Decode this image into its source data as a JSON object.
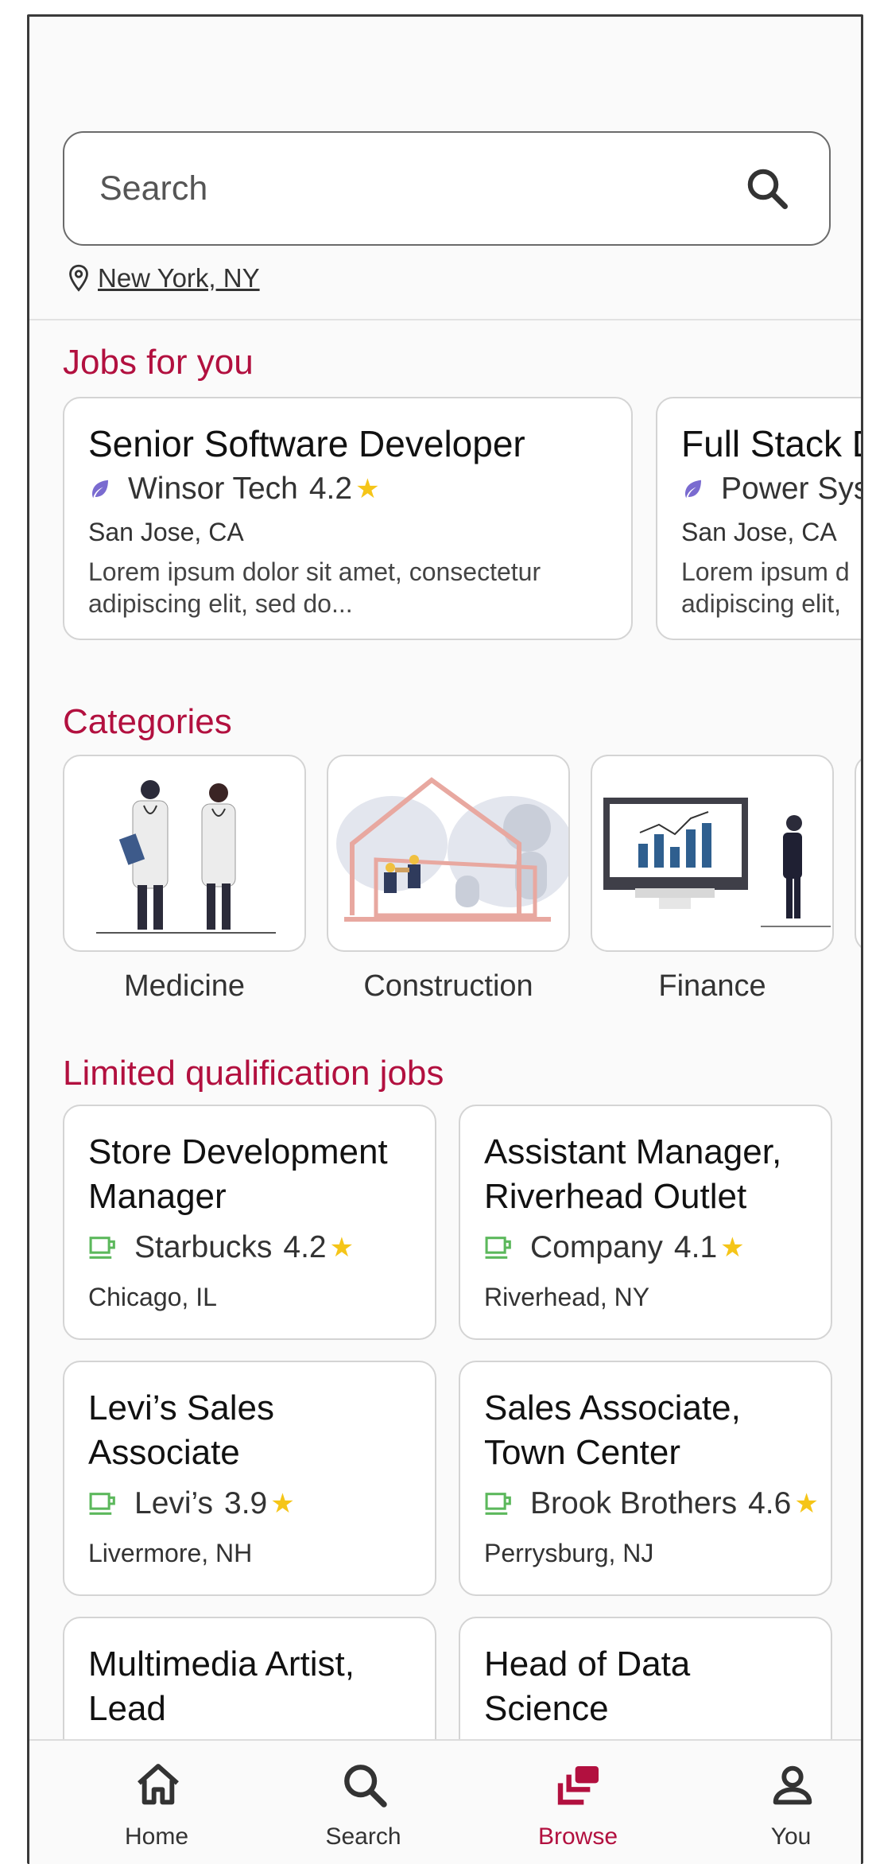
{
  "search": {
    "placeholder": "Search",
    "location": "New York, NY"
  },
  "sections": {
    "jobs_for_you": "Jobs for you",
    "categories": "Categories",
    "limited": "Limited qualification jobs"
  },
  "jobs_for_you": [
    {
      "title": "Senior Software Developer",
      "company": "Winsor Tech",
      "rating": "4.2",
      "location": "San Jose, CA",
      "description": "Lorem ipsum dolor sit amet, consectetur adipiscing elit, sed do..."
    },
    {
      "title": "Full Stack D",
      "company": "Power Sys",
      "location": "San Jose, CA",
      "description": "Lorem ipsum d adipiscing elit,"
    }
  ],
  "categories": [
    {
      "label": "Medicine"
    },
    {
      "label": "Construction"
    },
    {
      "label": "Finance"
    }
  ],
  "limited_jobs": [
    {
      "title": "Store Development Manager",
      "company": "Starbucks",
      "rating": "4.2",
      "location": "Chicago, IL"
    },
    {
      "title": "Assistant Manager, Riverhead Outlet",
      "company": "Company",
      "rating": "4.1",
      "location": "Riverhead, NY"
    },
    {
      "title": "Levi’s Sales Associate",
      "company": "Levi’s",
      "rating": "3.9",
      "location": "Livermore, NH"
    },
    {
      "title": "Sales Associate, Town Center",
      "company": "Brook Brothers",
      "rating": "4.6",
      "location": "Perrysburg, NJ"
    },
    {
      "title": "Multimedia Artist, Lead"
    },
    {
      "title": "Head of Data Science"
    }
  ],
  "nav": [
    {
      "label": "Home",
      "icon": "home-icon"
    },
    {
      "label": "Search",
      "icon": "search-icon"
    },
    {
      "label": "Browse",
      "icon": "browse-icon",
      "active": true
    },
    {
      "label": "You",
      "icon": "person-icon"
    }
  ],
  "colors": {
    "accent": "#b2103f",
    "star": "#f5c518",
    "leaf": "#7a6bd0",
    "cup": "#5cb85c"
  }
}
